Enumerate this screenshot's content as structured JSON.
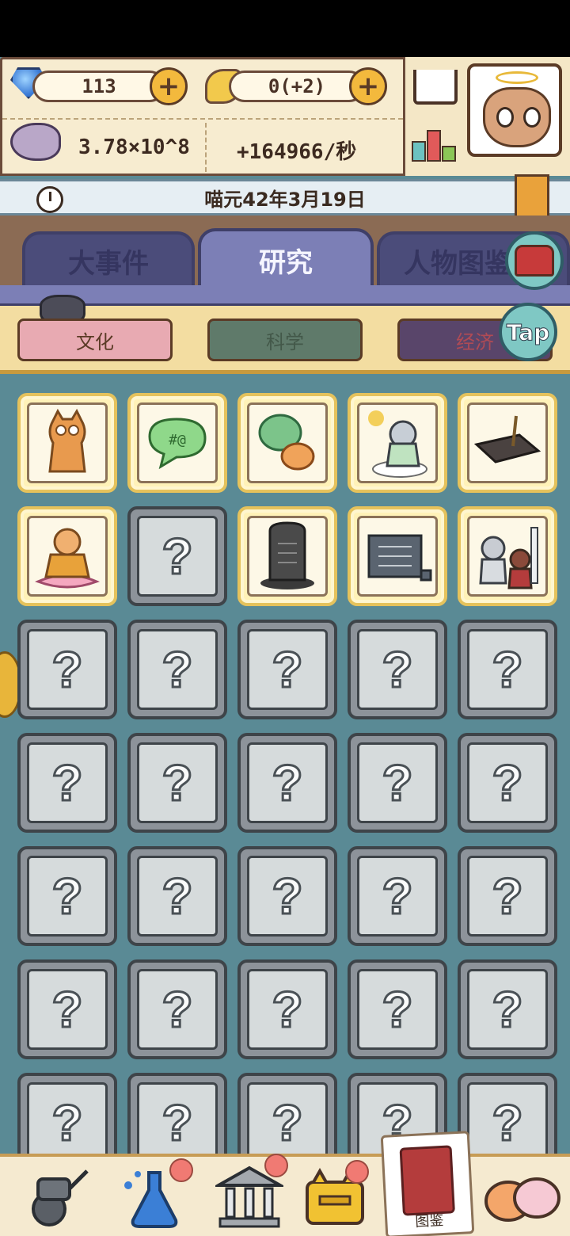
{
  "resources": {
    "gems": "113",
    "scrolls": "0(+2)",
    "fish_total": "3.78×10^8",
    "fish_rate": "+164966/秒"
  },
  "date": "喵元42年3月19日",
  "tabs": [
    {
      "label": "大事件",
      "active": false
    },
    {
      "label": "研究",
      "active": true
    },
    {
      "label": "人物图鉴",
      "active": false
    }
  ],
  "filters": [
    {
      "label": "文化",
      "active": true
    },
    {
      "label": "科学",
      "active": false
    },
    {
      "label": "经济",
      "active": false
    }
  ],
  "tap_label": "Tap",
  "grid": {
    "locked_glyph": "?",
    "rows": [
      [
        "cat-statue",
        "speech-bubble",
        "chat-bubbles",
        "immortal-cat",
        "ink-stone"
      ],
      [
        "buddha-cat",
        "locked",
        "stele",
        "scroll",
        "philosophers"
      ],
      [
        "locked",
        "locked",
        "locked",
        "locked",
        "locked"
      ],
      [
        "locked",
        "locked",
        "locked",
        "locked",
        "locked"
      ],
      [
        "locked",
        "locked",
        "locked",
        "locked",
        "locked"
      ],
      [
        "locked",
        "locked",
        "locked",
        "locked",
        "locked"
      ],
      [
        "locked",
        "locked",
        "locked",
        "locked",
        "locked"
      ]
    ]
  },
  "bottom_nav": {
    "handbook_label": "图鉴"
  },
  "colors": {
    "accent": "#7c7fb6",
    "parchment": "#f7ecd0",
    "background": "#5a8a95"
  }
}
